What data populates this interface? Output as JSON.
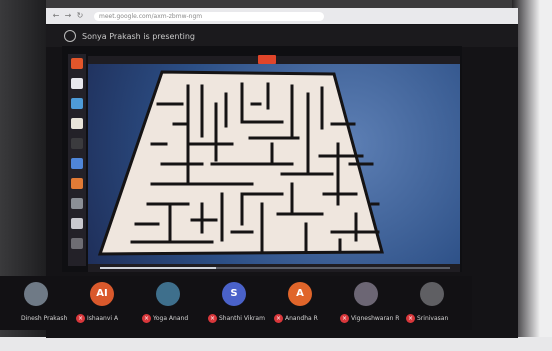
{
  "browser": {
    "address": "meet.google.com/axm-zbmw-ngm"
  },
  "meeting": {
    "presenting_text": "Sonya Prakash is presenting"
  },
  "game": {
    "progress": 0.33
  },
  "participants": [
    {
      "name": "Dinesh Prakash",
      "initial": "",
      "color": "#6f7a86",
      "muted": false
    },
    {
      "name": "Ishaanvi A",
      "initial": "AI",
      "color": "#d9592c",
      "muted": true
    },
    {
      "name": "Yoga Anand",
      "initial": "",
      "color": "#3e6f8c",
      "muted": true
    },
    {
      "name": "Shanthi Vikram",
      "initial": "S",
      "color": "#4a62c9",
      "muted": true
    },
    {
      "name": "Anandha R",
      "initial": "A",
      "color": "#e0652a",
      "muted": true
    },
    {
      "name": "Vigneshwaran R",
      "initial": "",
      "color": "#6c6674",
      "muted": true
    },
    {
      "name": "Srinivasan",
      "initial": "",
      "color": "#5f5f63",
      "muted": true
    }
  ],
  "dock_icons": [
    "ubuntu-icon",
    "firefox-icon",
    "files-icon",
    "mail-icon",
    "terminal-icon",
    "docs-icon",
    "store-icon",
    "settings-icon",
    "text-icon",
    "trash-icon"
  ],
  "colors": {
    "maze_floor": "#efe6de",
    "maze_wall": "#151314",
    "stage_blue": "#3f67a3",
    "mute_red": "#d9373b"
  }
}
